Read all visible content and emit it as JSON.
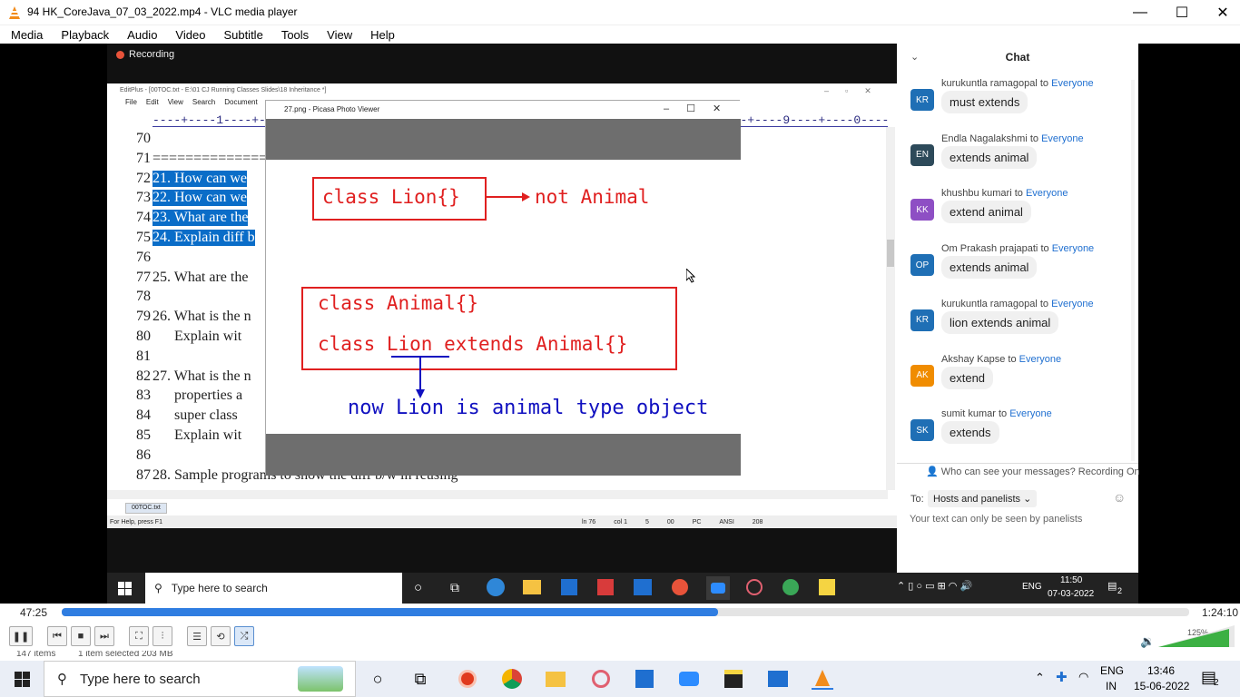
{
  "window": {
    "title": "94 HK_CoreJava_07_03_2022.mp4 - VLC media player",
    "minimize": "—",
    "maximize": "☐",
    "close": "✕"
  },
  "menu": [
    "Media",
    "Playback",
    "Audio",
    "Video",
    "Subtitle",
    "Tools",
    "View",
    "Help"
  ],
  "zoom": {
    "recording_label": "Recording"
  },
  "editplus": {
    "title": "EditPlus - [00TOC.txt - E:\\01 CJ Running Classes Slides\\18 Inheritance *]",
    "menu": [
      "File",
      "Edit",
      "View",
      "Search",
      "Document"
    ],
    "ruler": "----+----1----+----2----+----3----+----4----+----5----+----6----+----7----+----8----+----9----+----0----+----",
    "lines": [
      {
        "n": "70",
        "text": ""
      },
      {
        "n": "71",
        "text": "================================"
      },
      {
        "n": "72",
        "text": "21. How can we"
      },
      {
        "n": "73",
        "text": "22. How can we"
      },
      {
        "n": "74",
        "text": "23. What are the"
      },
      {
        "n": "75",
        "text": "24. Explain diff b"
      },
      {
        "n": "76",
        "text": ""
      },
      {
        "n": "77",
        "text": "25. What are the"
      },
      {
        "n": "78",
        "text": ""
      },
      {
        "n": "79",
        "text": "26. What is the n"
      },
      {
        "n": "80",
        "text": "      Explain wit"
      },
      {
        "n": "81",
        "text": ""
      },
      {
        "n": "82",
        "text": "27. What is the n"
      },
      {
        "n": "83",
        "text": "      properties a"
      },
      {
        "n": "84",
        "text": "      super class"
      },
      {
        "n": "85",
        "text": "      Explain wit"
      },
      {
        "n": "86",
        "text": ""
      },
      {
        "n": "87",
        "text": "28. Sample programs to show the diff b/w in reusing"
      }
    ],
    "tab": "00TOC.txt",
    "status": {
      "help": "For Help, press F1",
      "ln": "ln 76",
      "col": "col 1",
      "n1": "5",
      "n2": "00",
      "pc": "PC",
      "enc": "ANSI",
      "n3": "208"
    }
  },
  "picasa": {
    "title": "27.png - Picasa Photo Viewer"
  },
  "slide": {
    "box1": "class Lion{}",
    "not_animal": "not Animal",
    "line1": "class Animal{}",
    "line2_a": "class ",
    "line2_b": "Lion",
    "line2_c": " extends Animal{}",
    "bottom": "now Lion is animal type object"
  },
  "chat": {
    "title": "Chat",
    "messages": [
      {
        "initials": "KR",
        "color": "#1f6fb5",
        "sender": "kurukuntla ramagopal",
        "to": "Everyone",
        "text": "must extends"
      },
      {
        "initials": "EN",
        "color": "#2d4a5a",
        "sender": "Endla Nagalakshmi",
        "to": "Everyone",
        "text": "extends animal"
      },
      {
        "initials": "KK",
        "color": "#8e4fc4",
        "sender": "khushbu kumari",
        "to": "Everyone",
        "text": "extend animal"
      },
      {
        "initials": "OP",
        "color": "#1f6fb5",
        "sender": "Om Prakash prajapati",
        "to": "Everyone",
        "text": "extends animal"
      },
      {
        "initials": "KR",
        "color": "#1f6fb5",
        "sender": "kurukuntla ramagopal",
        "to": "Everyone",
        "text": "lion extends animal"
      },
      {
        "initials": "AK",
        "color": "#f08c00",
        "sender": "Akshay Kapse",
        "to": "Everyone",
        "text": "extend"
      },
      {
        "initials": "SK",
        "color": "#1f6fb5",
        "sender": "sumit kumar",
        "to": "Everyone",
        "text": "extends"
      }
    ],
    "to_word": "to",
    "who_can_see": "Who can see your messages? Recording On",
    "to_label": "To:",
    "to_value": "Hosts and panelists",
    "hint": "Your text can only be seen by panelists"
  },
  "inner_taskbar": {
    "search": "Type here to search",
    "lang": "ENG",
    "time": "11:50",
    "date": "07-03-2022",
    "notif": "2"
  },
  "player": {
    "elapsed": "47:25",
    "total": "1:24:10",
    "progress": 0.582,
    "volume": "125%"
  },
  "old_status": {
    "items": "147 items",
    "selected": "1 item selected  203 MB"
  },
  "taskbar": {
    "search": "Type here to search",
    "lang1": "ENG",
    "lang2": "IN",
    "time": "13:46",
    "date": "15-06-2022",
    "notif": "2"
  }
}
